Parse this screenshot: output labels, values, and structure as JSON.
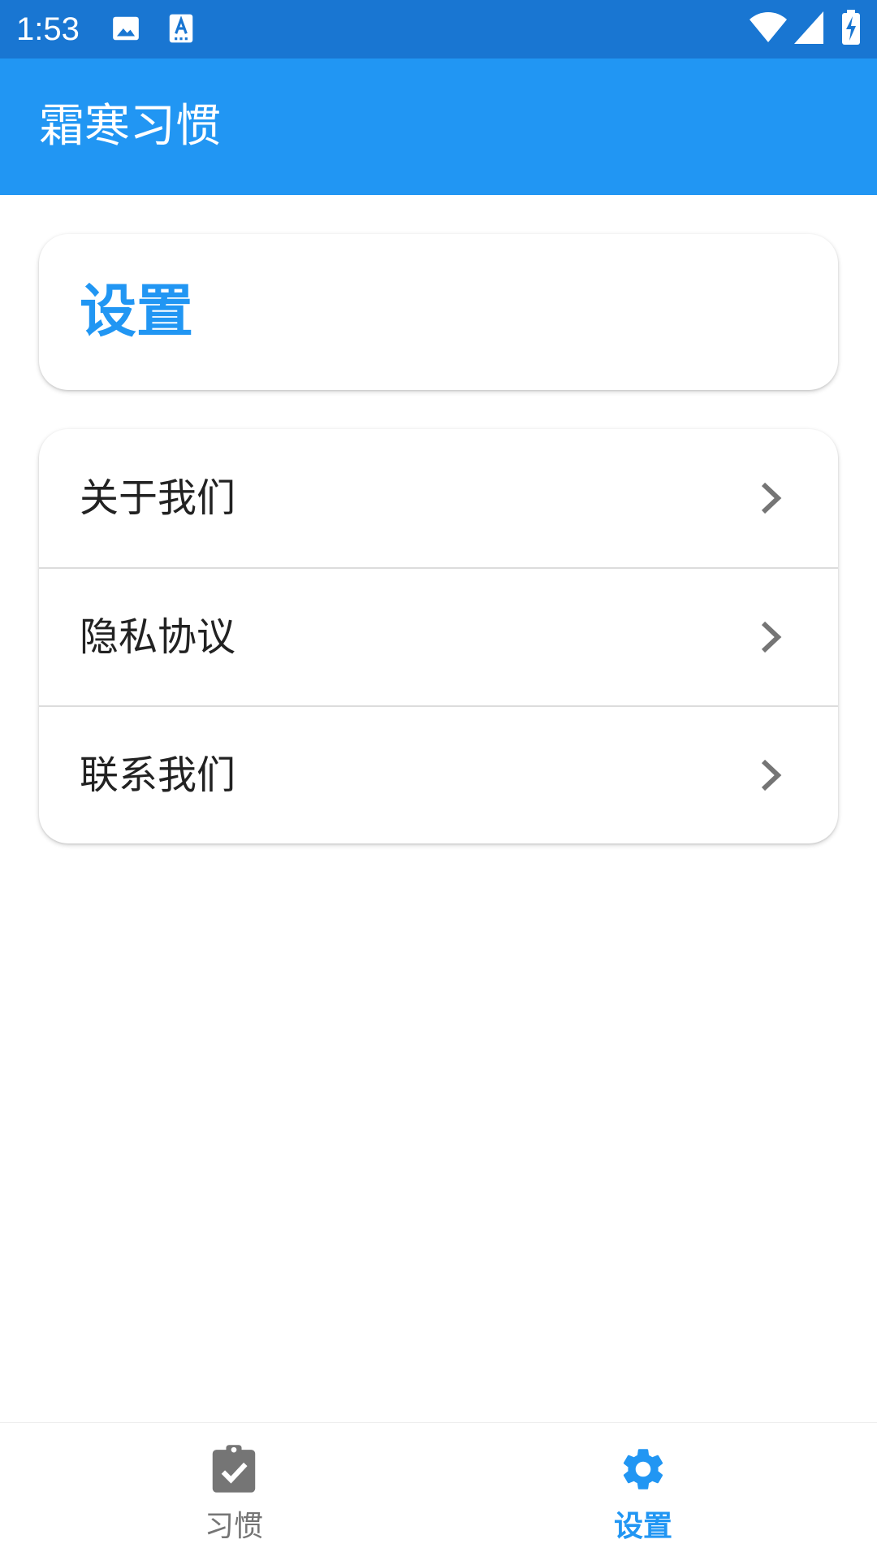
{
  "status_bar": {
    "time": "1:53",
    "icons": [
      "image-icon",
      "text-a-icon",
      "wifi-icon",
      "signal-icon",
      "battery-charging-icon"
    ]
  },
  "app_bar": {
    "title": "霜寒习惯"
  },
  "header_card": {
    "title": "设置"
  },
  "settings_list": {
    "items": [
      {
        "label": "关于我们",
        "icon": "chevron-right-icon"
      },
      {
        "label": "隐私协议",
        "icon": "chevron-right-icon"
      },
      {
        "label": "联系我们",
        "icon": "chevron-right-icon"
      }
    ]
  },
  "bottom_nav": {
    "items": [
      {
        "label": "习惯",
        "icon": "clipboard-check-icon",
        "active": false
      },
      {
        "label": "设置",
        "icon": "gear-icon",
        "active": true
      }
    ]
  },
  "colors": {
    "status_bar": "#1976D2",
    "primary": "#2196F3",
    "text": "#222222",
    "inactive": "#757575",
    "chevron": "#757575"
  }
}
